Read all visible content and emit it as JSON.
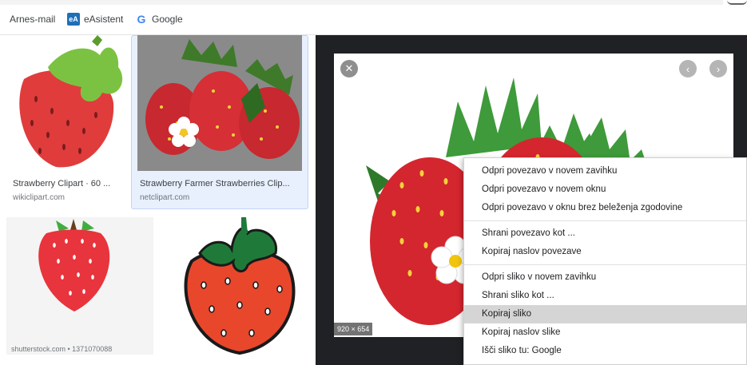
{
  "bookmarks": [
    {
      "label": "Arnes-mail",
      "icon": "none"
    },
    {
      "label": "eAsistent",
      "icon": "easistent-icon",
      "badge": "eA"
    },
    {
      "label": "Google",
      "icon": "google-icon",
      "badge": "G"
    }
  ],
  "results": [
    {
      "title": "Strawberry Clipart · 60 ...",
      "source": "wikiclipart.com"
    },
    {
      "title": "Strawberry Farmer Strawberries Clip...",
      "source": "netclipart.com"
    },
    {
      "title": "",
      "source": "shutterstock.com • 1371070088"
    },
    {
      "title": "",
      "source": ""
    }
  ],
  "preview": {
    "dimensions": "920 × 654",
    "close_glyph": "✕",
    "prev_glyph": "‹",
    "next_glyph": "›"
  },
  "context_menu": {
    "group1": [
      "Odpri povezavo v novem zavihku",
      "Odpri povezavo v novem oknu",
      "Odpri povezavo v oknu brez beleženja zgodovine"
    ],
    "group2": [
      "Shrani povezavo kot ...",
      "Kopiraj naslov povezave"
    ],
    "group3": [
      "Odpri sliko v novem zavihku",
      "Shrani sliko kot ...",
      "Kopiraj sliko",
      "Kopiraj naslov slike",
      "Išči sliko tu: Google"
    ],
    "highlighted": "Kopiraj sliko"
  },
  "colors": {
    "strawberry_red": "#e03c3c",
    "leaf_green": "#5cab2f",
    "panel_dark": "#202124",
    "menu_highlight": "#d5d5d5"
  }
}
